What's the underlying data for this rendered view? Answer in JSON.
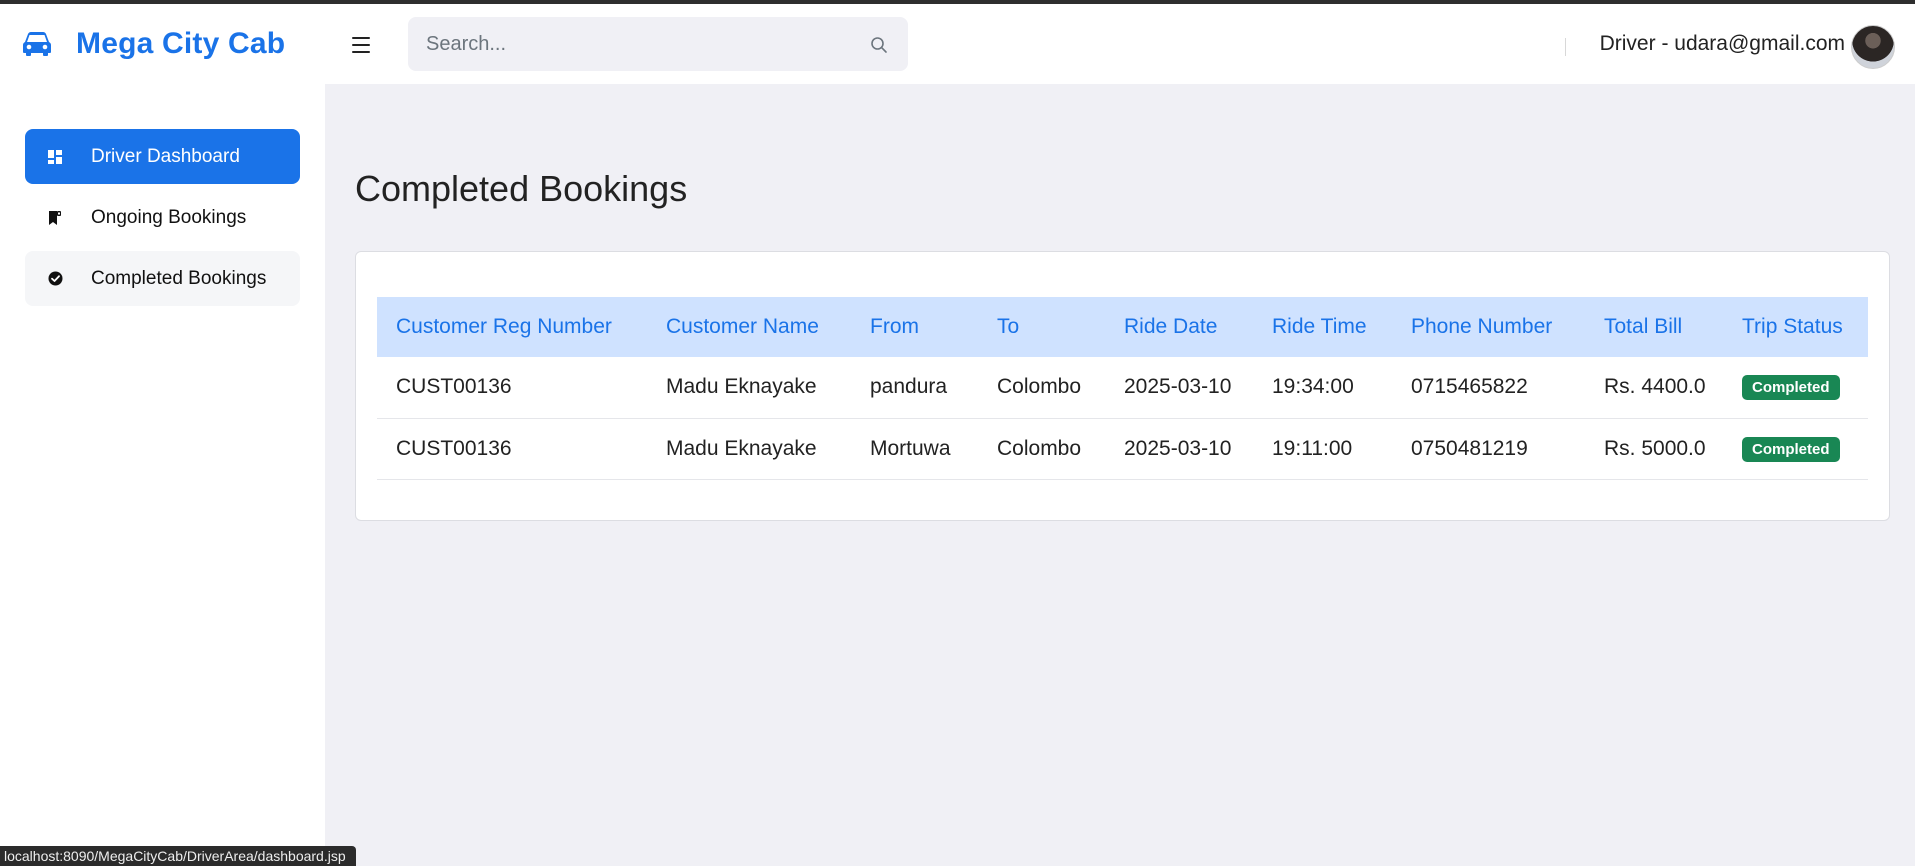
{
  "app": {
    "brand_name": "Mega City Cab",
    "brand_color": "#1a73e8",
    "brand_icon": "car-icon"
  },
  "header": {
    "search_placeholder": "Search...",
    "search_icon": "search-icon",
    "menu_icon": "hamburger-menu-icon",
    "user_label": "Driver - udara@gmail.com"
  },
  "sidebar": {
    "items": [
      {
        "label": "Driver Dashboard",
        "icon": "dashboard-icon",
        "state": "active"
      },
      {
        "label": "Ongoing Bookings",
        "icon": "bookmark-icon",
        "state": "normal"
      },
      {
        "label": "Completed Bookings",
        "icon": "check-circle-icon",
        "state": "hover"
      }
    ]
  },
  "main": {
    "title": "Completed Bookings",
    "table": {
      "headers": [
        "Customer Reg Number",
        "Customer Name",
        "From",
        "To",
        "Ride Date",
        "Ride Time",
        "Phone Number",
        "Total Bill",
        "Trip Status"
      ],
      "rows": [
        [
          "CUST00136",
          "Madu Eknayake",
          "pandura",
          "Colombo",
          "2025-03-10",
          "19:34:00",
          "0715465822",
          "Rs. 4400.0",
          "Completed"
        ],
        [
          "CUST00136",
          "Madu Eknayake",
          "Mortuwa",
          "Colombo",
          "2025-03-10",
          "19:11:00",
          "0750481219",
          "Rs. 5000.0",
          "Completed"
        ]
      ],
      "status_badge_color": "#198754",
      "header_bg_color": "#cfe2ff"
    }
  },
  "statusbar": {
    "url": "localhost:8090/MegaCityCab/DriverArea/dashboard.jsp"
  }
}
